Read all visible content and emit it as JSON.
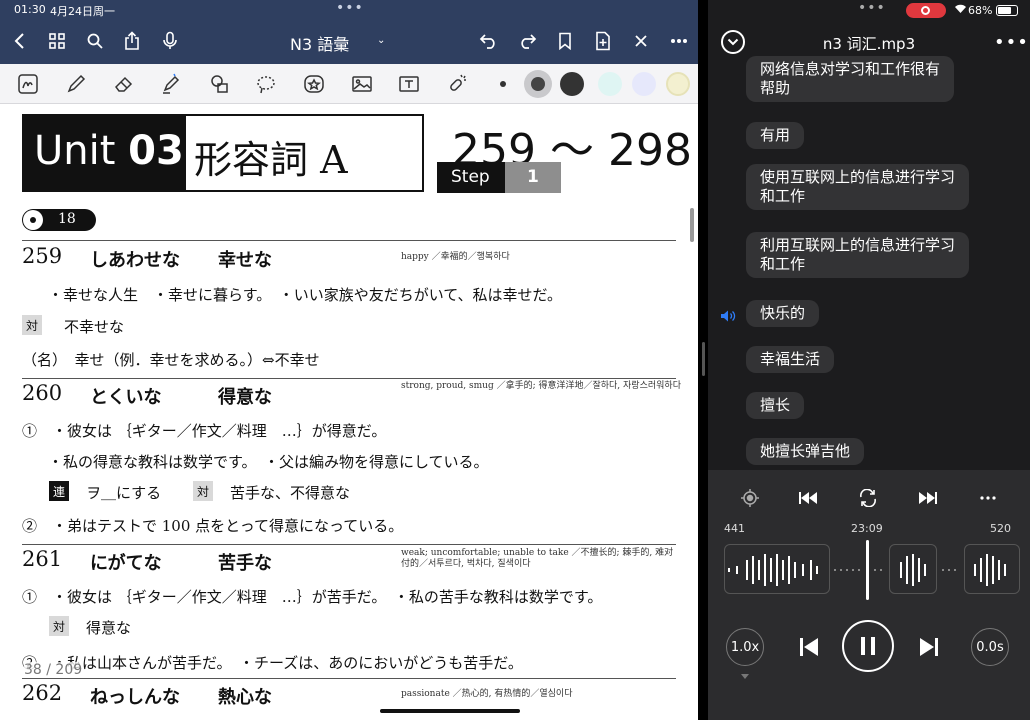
{
  "left": {
    "status": {
      "time": "01:30",
      "date": "4月24日周一"
    },
    "navbar": {
      "title": "N3 語彙",
      "caret": "⌄"
    },
    "page": {
      "unit": {
        "word": "Unit",
        "number": "03",
        "title": "形容詞 A"
      },
      "range": "259 〜 298",
      "step": {
        "label": "Step",
        "number": "1"
      },
      "track": "18",
      "entries": [
        {
          "num": "259",
          "kana": "しあわせな",
          "kanji": "幸せな",
          "meaning": "happy ／幸福的／행복하다",
          "lines": [
            "・幸せな人生　・幸せに暮らす。　・いい家族や友だちがいて、私は幸せだ。",
            "不幸せな",
            "（名）　幸せ（例．幸せを求める。）⇔不幸せ"
          ],
          "tags": [
            "対"
          ]
        },
        {
          "num": "260",
          "kana": "とくいな",
          "kanji": "得意な",
          "meaning": "strong, proud, smug ／拿手的; 得意洋洋地／잘하다, 자랑스러워하다",
          "lines": [
            "①　・彼女は ｛ギター／作文／料理　…｝が得意だ。",
            "・私の得意な教科は数学です。　・父は編み物を得意にしている。",
            "ヲ＿にする",
            "苦手な、不得意な",
            "②　・弟はテストで 100 点をとって得意になっている。"
          ],
          "tags": [
            "連",
            "対"
          ]
        },
        {
          "num": "261",
          "kana": "にがてな",
          "kanji": "苦手な",
          "meaning": "weak; uncomfortable; unable to take ／不擅长的; 棘手的, 难对付的／서투르다, 벅차다, 질색이다",
          "lines": [
            "①　・彼女は ｛ギター／作文／料理　…｝が苦手だ。　・私の苦手な教科は数学です。",
            "得意な",
            "②　・私は山本さんが苦手だ。　・チーズは、あのにおいがどうも苦手だ。"
          ],
          "tags": [
            "対"
          ]
        },
        {
          "num": "262",
          "kana": "ねっしんな",
          "kanji": "熱心な",
          "meaning": "passionate ／热心的, 有热情的／열심이다"
        }
      ],
      "counter": "38 / 209"
    }
  },
  "right": {
    "status": {
      "battery": "68%"
    },
    "title": "n3 词汇.mp3",
    "transcript": [
      "网络信息对学习和工作很有\n帮助",
      "有用",
      "使用互联网上的信息进行学习\n和工作",
      "利用互联网上的信息进行学习\n和工作",
      "快乐的",
      "幸福生活",
      "擅长",
      "她擅长弹吉他"
    ],
    "player": {
      "left_marker": "441",
      "current_time": "23:09",
      "right_marker": "520",
      "speed": "1.0x",
      "offset": "0.0s"
    }
  },
  "colors": {
    "nav": "#2f3f60",
    "player_bg": "#1c1c1e",
    "controls_bg": "#2c2c2e",
    "bubble": "#333335",
    "accent_blue": "#2f7cf6",
    "record_red": "#e0383e"
  }
}
